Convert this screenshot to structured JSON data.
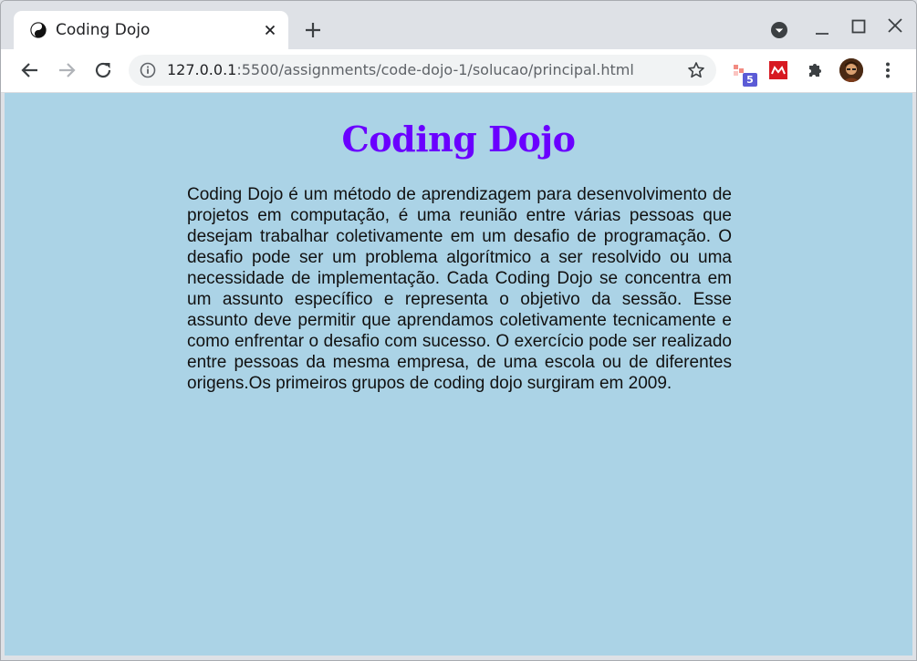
{
  "browser": {
    "tab": {
      "title": "Coding Dojo",
      "favicon": "yin-yang-icon"
    },
    "address_bar": {
      "host": "127.0.0.1",
      "path": ":5500/assignments/code-dojo-1/solucao/principal.html"
    },
    "extensions": {
      "badge_count": "5"
    }
  },
  "page": {
    "title": "Coding Dojo",
    "title_color": "#6a00ff",
    "background": "#abd3e6",
    "paragraph": "Coding Dojo é um método de aprendizagem para desenvolvimento de projetos em computação, é uma reunião entre várias pessoas que desejam trabalhar coletivamente em um desafio de programação. O desafio pode ser um problema algorítmico a ser resolvido ou uma necessidade de implementação. Cada Coding Dojo se concentra em um assunto específico e representa o objetivo da sessão. Esse assunto deve permitir que aprendamos coletivamente tecnicamente e como enfrentar o desafio com sucesso. O exercício pode ser realizado entre pessoas da mesma empresa, de uma escola ou de diferentes origens.Os primeiros grupos de coding dojo surgiram em 2009."
  }
}
